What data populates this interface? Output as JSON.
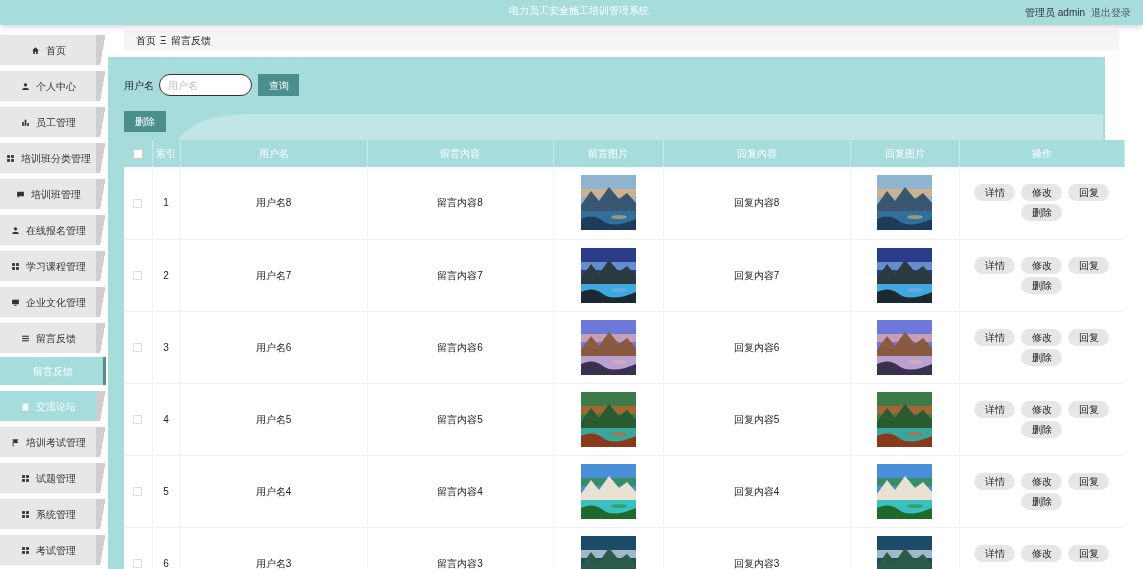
{
  "header": {
    "title": "电力员工安全施工培训管理系统",
    "user_label": "管理员 admin",
    "logout": "退出登录"
  },
  "sidebar": {
    "items": [
      {
        "label": "首页",
        "highlighted": false
      },
      {
        "label": "个人中心",
        "highlighted": false
      },
      {
        "label": "员工管理",
        "highlighted": false
      },
      {
        "label": "培训班分类管理",
        "highlighted": false
      },
      {
        "label": "培训班管理",
        "highlighted": false
      },
      {
        "label": "在线报名管理",
        "highlighted": false
      },
      {
        "label": "学习课程管理",
        "highlighted": false
      },
      {
        "label": "企业文化管理",
        "highlighted": false
      },
      {
        "label": "留言反馈",
        "highlighted": false,
        "children": [
          {
            "label": "留言反馈",
            "selected": true
          }
        ]
      },
      {
        "label": "交流论坛",
        "highlighted": true
      },
      {
        "label": "培训考试管理",
        "highlighted": false
      },
      {
        "label": "试题管理",
        "highlighted": false
      },
      {
        "label": "系统管理",
        "highlighted": false
      },
      {
        "label": "考试管理",
        "highlighted": false
      }
    ]
  },
  "breadcrumb": [
    "首页",
    "Ξ",
    "留言反馈"
  ],
  "search": {
    "label": "用户名",
    "placeholder": "用户名",
    "button": "查询"
  },
  "delete_button": "删除",
  "table": {
    "select_all_checked": false,
    "columns": [
      "索引",
      "用户名",
      "留言内容",
      "留言图片",
      "回复内容",
      "回复图片",
      "操作"
    ],
    "rows": [
      {
        "checked": false,
        "index": "1",
        "username": "用户名8",
        "content": "留言内容8",
        "image": {
          "kind": "picture"
        },
        "reply": "回复内容8",
        "reply_image": {
          "kind": "picture"
        },
        "actions": [
          "详情",
          "修改",
          "回复",
          "删除"
        ]
      },
      {
        "checked": false,
        "index": "2",
        "username": "用户名7",
        "content": "留言内容7",
        "image": {
          "kind": "picture"
        },
        "reply": "回复内容7",
        "reply_image": {
          "kind": "picture"
        },
        "actions": [
          "详情",
          "修改",
          "回复",
          "删除"
        ]
      },
      {
        "checked": false,
        "index": "3",
        "username": "用户名6",
        "content": "留言内容6",
        "image": {
          "kind": "picture"
        },
        "reply": "回复内容6",
        "reply_image": {
          "kind": "picture"
        },
        "actions": [
          "详情",
          "修改",
          "回复",
          "删除"
        ]
      },
      {
        "checked": false,
        "index": "4",
        "username": "用户名5",
        "content": "留言内容5",
        "image": {
          "kind": "picture"
        },
        "reply": "回复内容5",
        "reply_image": {
          "kind": "picture"
        },
        "actions": [
          "详情",
          "修改",
          "回复",
          "删除"
        ]
      },
      {
        "checked": false,
        "index": "5",
        "username": "用户名4",
        "content": "留言内容4",
        "image": {
          "kind": "picture"
        },
        "reply": "回复内容4",
        "reply_image": {
          "kind": "picture"
        },
        "actions": [
          "详情",
          "修改",
          "回复",
          "删除"
        ]
      },
      {
        "checked": false,
        "index": "6",
        "username": "用户名3",
        "content": "留言内容3",
        "image": {
          "kind": "picture"
        },
        "reply": "回复内容3",
        "reply_image": {
          "kind": "picture"
        },
        "actions": [
          "详情",
          "修改",
          "回复"
        ]
      }
    ]
  }
}
